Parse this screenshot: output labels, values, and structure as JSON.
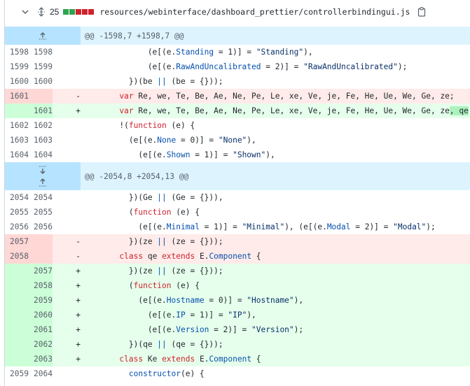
{
  "file": {
    "changes_count": "25",
    "path": "resources/webinterface/dashboard_prettier/controllerbindingui.js",
    "diffstat_colors": [
      "#2da44e",
      "#2da44e",
      "#cf222e",
      "#cf222e",
      "#cf222e"
    ]
  },
  "hunks": {
    "hunk1": "@@ -1598,7 +1598,7 @@",
    "hunk2": "@@ -2054,8 +2054,13 @@"
  },
  "colors": {
    "keyword": "#cf222e",
    "property": "#0550ae",
    "string": "#0a3069",
    "added_bg": "#e6ffec",
    "removed_bg": "#ffebe9",
    "hunk_bg": "#ddf4ff"
  },
  "lines": [
    {
      "old": "1598",
      "new": "1598",
      "sign": "",
      "code": "            (e[(e.Standing = 1)] = \"Standing\"),"
    },
    {
      "old": "1599",
      "new": "1599",
      "sign": "",
      "code": "            (e[(e.RawAndUncalibrated = 2)] = \"RawAndUncalibrated\");"
    },
    {
      "old": "1600",
      "new": "1600",
      "sign": "",
      "code": "        })(be || (be = {}));"
    },
    {
      "old": "1601",
      "new": "",
      "sign": "-",
      "code": "      var Re, we, Te, Be, Ae, Ne, Pe, Le, xe, Ve, je, Fe, He, Ue, We, Ge, ze;"
    },
    {
      "old": "",
      "new": "1601",
      "sign": "+",
      "code": "      var Re, we, Te, Be, Ae, Ne, Pe, Le, xe, Ve, je, Fe, He, Ue, We, Ge, ze, qe;"
    },
    {
      "old": "1602",
      "new": "1602",
      "sign": "",
      "code": "      !(function (e) {"
    },
    {
      "old": "1603",
      "new": "1603",
      "sign": "",
      "code": "        (e[(e.None = 0)] = \"None\"),"
    },
    {
      "old": "1604",
      "new": "1604",
      "sign": "",
      "code": "          (e[(e.Shown = 1)] = \"Shown\"),"
    },
    {
      "old": "2054",
      "new": "2054",
      "sign": "",
      "code": "        })(Ge || (Ge = {})),"
    },
    {
      "old": "2055",
      "new": "2055",
      "sign": "",
      "code": "        (function (e) {"
    },
    {
      "old": "2056",
      "new": "2056",
      "sign": "",
      "code": "          (e[(e.Minimal = 1)] = \"Minimal\"), (e[(e.Modal = 2)] = \"Modal\");"
    },
    {
      "old": "2057",
      "new": "",
      "sign": "-",
      "code": "        })(ze || (ze = {}));"
    },
    {
      "old": "2058",
      "new": "",
      "sign": "-",
      "code": "      class qe extends E.Component {"
    },
    {
      "old": "",
      "new": "2057",
      "sign": "+",
      "code": "        })(ze || (ze = {}));"
    },
    {
      "old": "",
      "new": "2058",
      "sign": "+",
      "code": "        (function (e) {"
    },
    {
      "old": "",
      "new": "2059",
      "sign": "+",
      "code": "          (e[(e.Hostname = 0)] = \"Hostname\"),"
    },
    {
      "old": "",
      "new": "2060",
      "sign": "+",
      "code": "            (e[(e.IP = 1)] = \"IP\"),"
    },
    {
      "old": "",
      "new": "2061",
      "sign": "+",
      "code": "            (e[(e.Version = 2)] = \"Version\");"
    },
    {
      "old": "",
      "new": "2062",
      "sign": "+",
      "code": "        })(qe || (qe = {}));"
    },
    {
      "old": "",
      "new": "2063",
      "sign": "+",
      "code": "      class Ke extends E.Component {"
    },
    {
      "old": "2059",
      "new": "2064",
      "sign": "",
      "code": "        constructor(e) {"
    }
  ]
}
